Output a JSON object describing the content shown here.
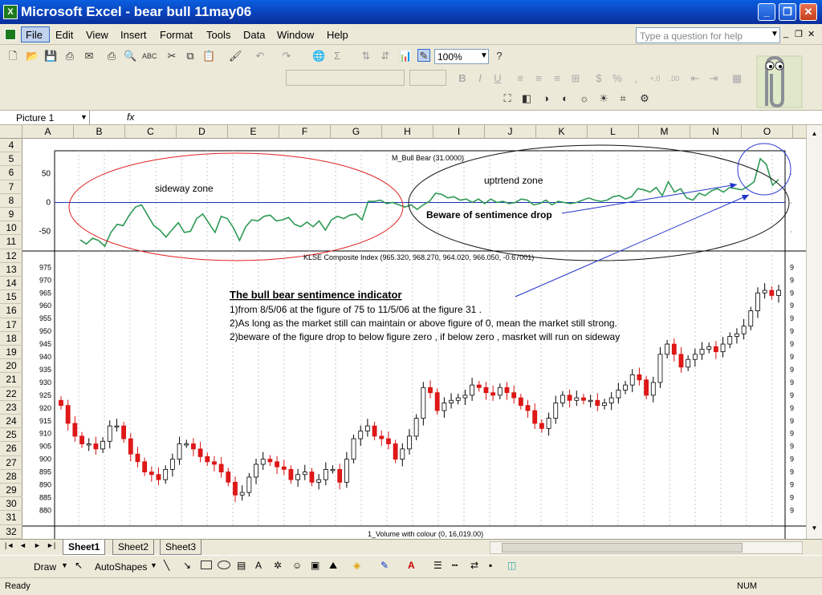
{
  "window": {
    "title": "Microsoft Excel - bear bull 11may06"
  },
  "menu": [
    "File",
    "Edit",
    "View",
    "Insert",
    "Format",
    "Tools",
    "Data",
    "Window",
    "Help"
  ],
  "help_placeholder": "Type a question for help",
  "toolbar": {
    "zoom": "100%"
  },
  "namebox": "Picture 1",
  "fx": "fx",
  "columns": [
    "A",
    "B",
    "C",
    "D",
    "E",
    "F",
    "G",
    "H",
    "I",
    "J",
    "K",
    "L",
    "M",
    "N",
    "O"
  ],
  "rows": [
    "4",
    "5",
    "6",
    "7",
    "8",
    "9",
    "10",
    "11",
    "12",
    "13",
    "14",
    "15",
    "16",
    "17",
    "18",
    "19",
    "20",
    "21",
    "22",
    "23",
    "24",
    "25",
    "26",
    "27",
    "28",
    "29",
    "30",
    "31",
    "32"
  ],
  "chart_data": [
    {
      "type": "line",
      "title": "M_Bull Bear (31.0000)",
      "yticks": [
        "50",
        "0",
        "-50"
      ],
      "ylim": [
        -80,
        80
      ],
      "series": [
        {
          "values": [
            -65,
            -72,
            -62,
            -66,
            -76,
            -52,
            -38,
            -40,
            -22,
            -8,
            -4,
            -22,
            -40,
            -48,
            -60,
            -47,
            -35,
            -52,
            -50,
            -28,
            -20,
            -36,
            -52,
            -24,
            -28,
            -44,
            -66,
            -42,
            -30,
            -32,
            -24,
            -22,
            -32,
            -30,
            -26,
            -38,
            -42,
            -34,
            -42,
            -32,
            -48,
            -30,
            -24,
            -28,
            -22,
            -20,
            -30,
            2,
            2,
            4,
            -2,
            0,
            -4,
            -8,
            -4,
            -12,
            -4,
            2,
            16,
            14,
            8,
            10,
            4,
            6,
            0,
            6,
            -2,
            6,
            0,
            2,
            -2,
            0,
            6,
            4,
            -4,
            -2,
            4,
            -4,
            2,
            0,
            -2,
            0,
            4,
            8,
            4,
            2,
            4,
            10,
            12,
            6,
            10,
            24,
            22,
            18,
            26,
            12,
            36,
            18,
            24,
            8,
            4,
            16,
            12,
            20,
            24,
            18,
            26,
            24,
            22,
            28,
            36,
            76,
            66,
            30,
            40
          ]
        }
      ],
      "annotations": {
        "sideway": "sideway zone",
        "uptrend": "uptrtend zone",
        "beware": "Beware of sentimence drop"
      }
    },
    {
      "type": "candlestick",
      "title": "KLSE Composite Index (965.320, 968.270, 964.020, 966.050, -0.67001)",
      "yticks": [
        "975",
        "970",
        "965",
        "960",
        "955",
        "950",
        "945",
        "940",
        "935",
        "930",
        "925",
        "920",
        "915",
        "910",
        "905",
        "900",
        "895",
        "890",
        "885",
        "880"
      ],
      "ylim": [
        877,
        977
      ],
      "closes": [
        921,
        914,
        909,
        906,
        906,
        904,
        907,
        913,
        913,
        908,
        902,
        899,
        895,
        894,
        892,
        896,
        900,
        906,
        906,
        904,
        901,
        899,
        898,
        895,
        891,
        886,
        887,
        893,
        898,
        900,
        899,
        897,
        896,
        892,
        894,
        895,
        891,
        892,
        896,
        896,
        891,
        900,
        908,
        911,
        913,
        909,
        908,
        906,
        900,
        904,
        909,
        916,
        928,
        926,
        919,
        922,
        923,
        924,
        925,
        929,
        928,
        926,
        925,
        928,
        926,
        924,
        921,
        919,
        914,
        912,
        916,
        922,
        925,
        923,
        924,
        923,
        923,
        921,
        922,
        924,
        927,
        929,
        933,
        931,
        925,
        930,
        941,
        945,
        941,
        936,
        939,
        941,
        943,
        944,
        942,
        945,
        948,
        949,
        952,
        958,
        965,
        966,
        964,
        966
      ]
    },
    {
      "type": "bar",
      "title": "1_Volume with colour (0, 16,019.00)"
    }
  ],
  "text_box": {
    "heading": "The bull bear sentimence indicator",
    "line1": "1)from 8/5/06 at the figure of 75 to 11/5/06 at the figure 31 .",
    "line2": "2)As long as the market still can maintain or above figure of 0, mean the market still strong.",
    "line3": "2)beware of the figure drop to below figure zero , if below zero , masrket will run on sideway"
  },
  "sheets": [
    "Sheet1",
    "Sheet2",
    "Sheet3"
  ],
  "drawbar": {
    "draw": "Draw",
    "autoshapes": "AutoShapes"
  },
  "status": {
    "left": "Ready",
    "num": "NUM"
  }
}
